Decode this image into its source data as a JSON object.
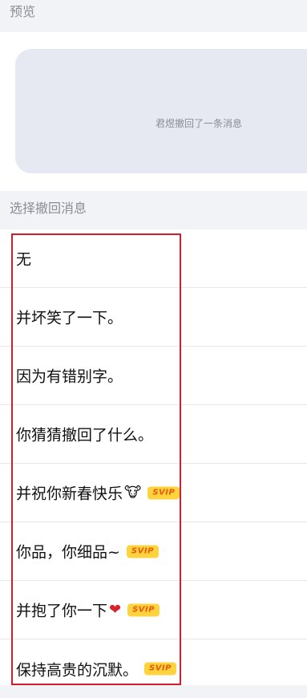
{
  "sections": {
    "preview_title": "预览",
    "select_title": "选择撤回消息"
  },
  "preview": {
    "message": "君煜撤回了一条消息"
  },
  "messages": [
    {
      "label": "无"
    },
    {
      "label": "并坏笑了一下。"
    },
    {
      "label": "因为有错别字。"
    },
    {
      "label": "你猜猜撤回了什么。"
    },
    {
      "label": "并祝你新春快乐",
      "emoji": "🐮",
      "emoji_name": "cow-icon",
      "badge": "SVIP"
    },
    {
      "label": "你品，你细品~",
      "badge": "SVIP"
    },
    {
      "label": "并抱了你一下",
      "emoji": "❤",
      "emoji_name": "red-heart-icon",
      "badge": "SVIP"
    },
    {
      "label": "保持高贵的沉默。",
      "badge": "SVIP"
    }
  ],
  "colors": {
    "highlight_border": "#d31d2b",
    "svip_bg": "#ffd33d",
    "svip_text": "#e85a0c"
  }
}
